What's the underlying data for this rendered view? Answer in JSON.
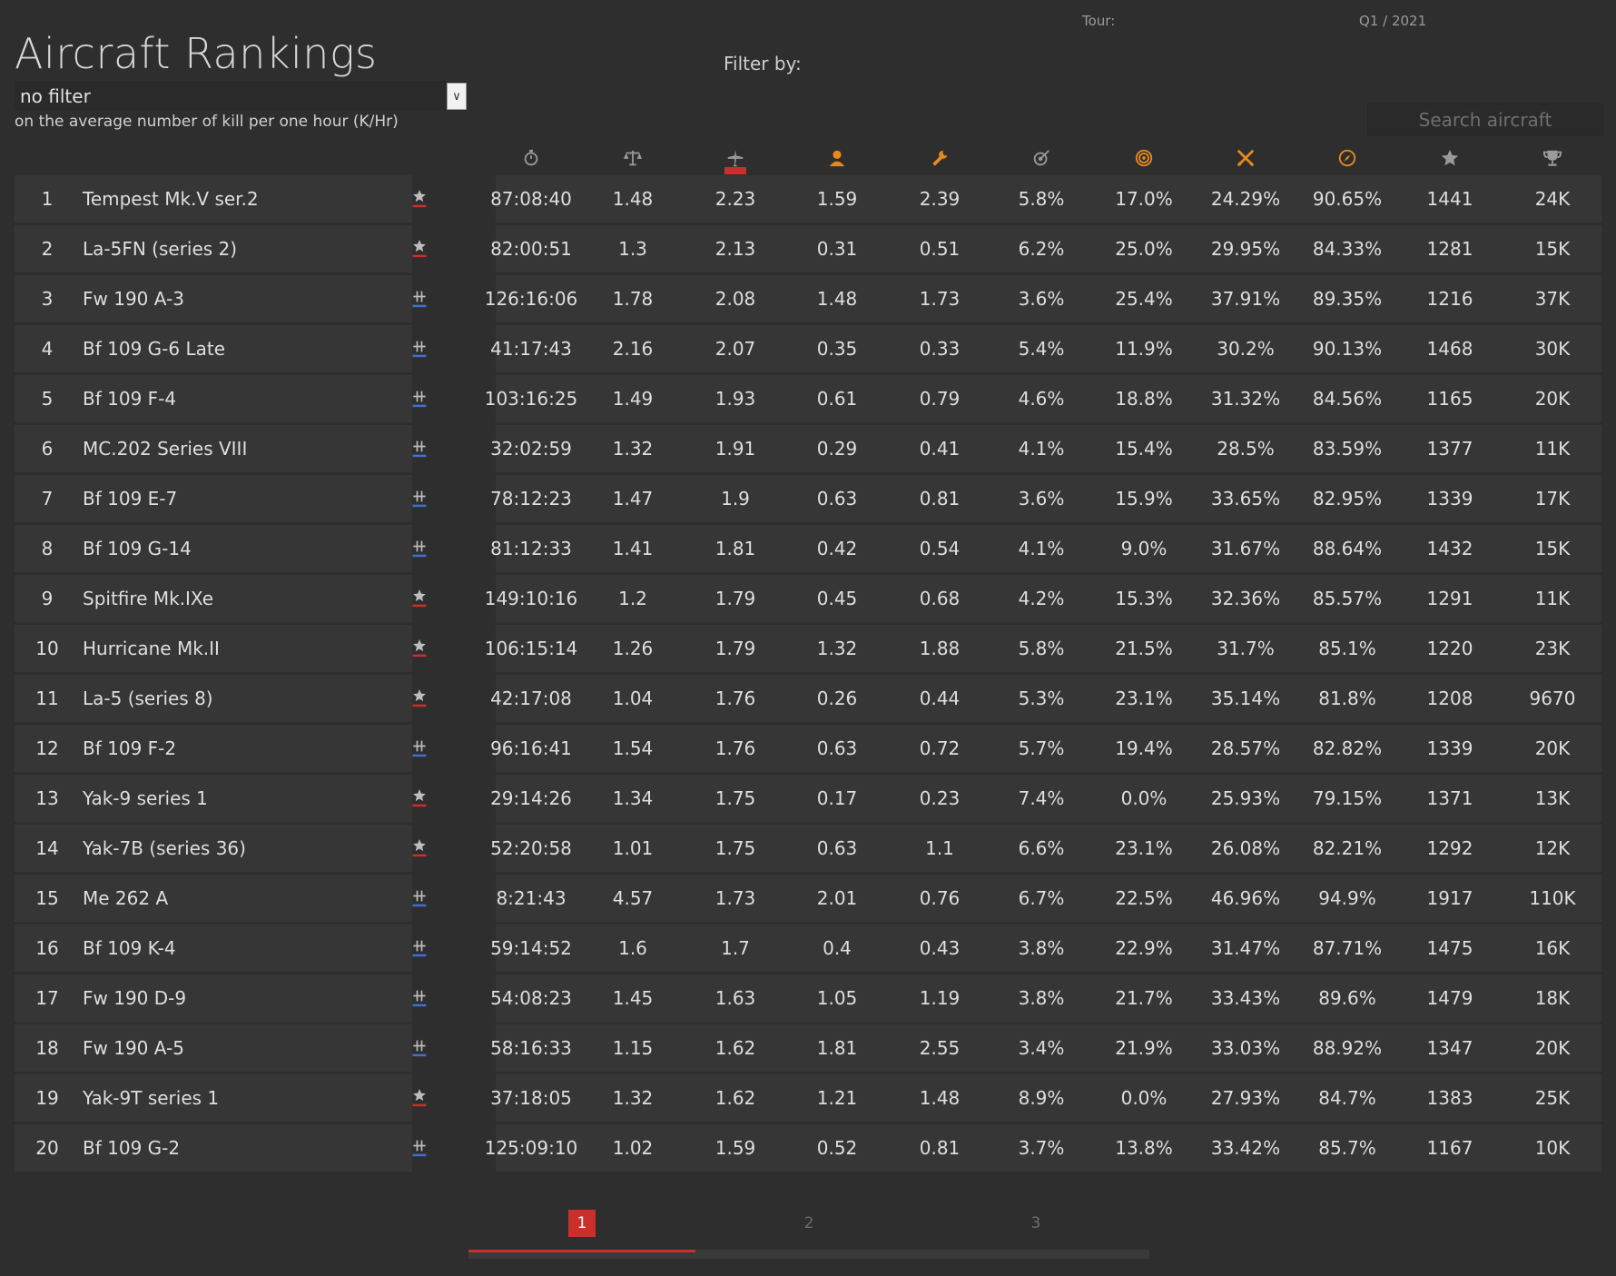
{
  "tour": {
    "label": "Tour:",
    "value": "Q1 / 2021"
  },
  "title": "Aircraft Rankings",
  "filter": {
    "label": "Filter by:",
    "selected": "no filter",
    "description": "on the average number of kill per one hour (K/Hr)"
  },
  "search": {
    "placeholder": "Search aircraft"
  },
  "columns": [
    {
      "icon": "stopwatch-icon",
      "color": "#9a9a9a"
    },
    {
      "icon": "scales-icon",
      "color": "#9a9a9a"
    },
    {
      "icon": "plane-kill-icon",
      "color": "#9a9a9a",
      "sorted": true
    },
    {
      "icon": "pilot-icon",
      "color": "#e58a1f"
    },
    {
      "icon": "wrench-icon",
      "color": "#e58a1f"
    },
    {
      "icon": "target-icon",
      "color": "#9a9a9a"
    },
    {
      "icon": "bullseye-icon",
      "color": "#e58a1f"
    },
    {
      "icon": "crossed-swords-icon",
      "color": "#e58a1f"
    },
    {
      "icon": "compass-icon",
      "color": "#e58a1f"
    },
    {
      "icon": "star-icon",
      "color": "#9a9a9a"
    },
    {
      "icon": "trophy-icon",
      "color": "#9a9a9a"
    }
  ],
  "colors": {
    "allies": "#c9302c",
    "axis": "#3f6fd1",
    "accent": "#c9302c"
  },
  "rows": [
    {
      "rank": "1",
      "name": "Tempest Mk.V ser.2",
      "side": "allies",
      "values": [
        "87:08:40",
        "1.48",
        "2.23",
        "1.59",
        "2.39",
        "5.8%",
        "17.0%",
        "24.29%",
        "90.65%",
        "1441",
        "24K"
      ]
    },
    {
      "rank": "2",
      "name": "La-5FN (series 2)",
      "side": "allies",
      "values": [
        "82:00:51",
        "1.3",
        "2.13",
        "0.31",
        "0.51",
        "6.2%",
        "25.0%",
        "29.95%",
        "84.33%",
        "1281",
        "15K"
      ]
    },
    {
      "rank": "3",
      "name": "Fw 190 A-3",
      "side": "axis",
      "values": [
        "126:16:06",
        "1.78",
        "2.08",
        "1.48",
        "1.73",
        "3.6%",
        "25.4%",
        "37.91%",
        "89.35%",
        "1216",
        "37K"
      ]
    },
    {
      "rank": "4",
      "name": "Bf 109 G-6 Late",
      "side": "axis",
      "values": [
        "41:17:43",
        "2.16",
        "2.07",
        "0.35",
        "0.33",
        "5.4%",
        "11.9%",
        "30.2%",
        "90.13%",
        "1468",
        "30K"
      ]
    },
    {
      "rank": "5",
      "name": "Bf 109 F-4",
      "side": "axis",
      "values": [
        "103:16:25",
        "1.49",
        "1.93",
        "0.61",
        "0.79",
        "4.6%",
        "18.8%",
        "31.32%",
        "84.56%",
        "1165",
        "20K"
      ]
    },
    {
      "rank": "6",
      "name": "MC.202 Series VIII",
      "side": "axis",
      "values": [
        "32:02:59",
        "1.32",
        "1.91",
        "0.29",
        "0.41",
        "4.1%",
        "15.4%",
        "28.5%",
        "83.59%",
        "1377",
        "11K"
      ]
    },
    {
      "rank": "7",
      "name": "Bf 109 E-7",
      "side": "axis",
      "values": [
        "78:12:23",
        "1.47",
        "1.9",
        "0.63",
        "0.81",
        "3.6%",
        "15.9%",
        "33.65%",
        "82.95%",
        "1339",
        "17K"
      ]
    },
    {
      "rank": "8",
      "name": "Bf 109 G-14",
      "side": "axis",
      "values": [
        "81:12:33",
        "1.41",
        "1.81",
        "0.42",
        "0.54",
        "4.1%",
        "9.0%",
        "31.67%",
        "88.64%",
        "1432",
        "15K"
      ]
    },
    {
      "rank": "9",
      "name": "Spitfire Mk.IXe",
      "side": "allies",
      "values": [
        "149:10:16",
        "1.2",
        "1.79",
        "0.45",
        "0.68",
        "4.2%",
        "15.3%",
        "32.36%",
        "85.57%",
        "1291",
        "11K"
      ]
    },
    {
      "rank": "10",
      "name": "Hurricane Mk.II",
      "side": "allies",
      "values": [
        "106:15:14",
        "1.26",
        "1.79",
        "1.32",
        "1.88",
        "5.8%",
        "21.5%",
        "31.7%",
        "85.1%",
        "1220",
        "23K"
      ]
    },
    {
      "rank": "11",
      "name": "La-5 (series 8)",
      "side": "allies",
      "values": [
        "42:17:08",
        "1.04",
        "1.76",
        "0.26",
        "0.44",
        "5.3%",
        "23.1%",
        "35.14%",
        "81.8%",
        "1208",
        "9670"
      ]
    },
    {
      "rank": "12",
      "name": "Bf 109 F-2",
      "side": "axis",
      "values": [
        "96:16:41",
        "1.54",
        "1.76",
        "0.63",
        "0.72",
        "5.7%",
        "19.4%",
        "28.57%",
        "82.82%",
        "1339",
        "20K"
      ]
    },
    {
      "rank": "13",
      "name": "Yak-9 series 1",
      "side": "allies",
      "values": [
        "29:14:26",
        "1.34",
        "1.75",
        "0.17",
        "0.23",
        "7.4%",
        "0.0%",
        "25.93%",
        "79.15%",
        "1371",
        "13K"
      ]
    },
    {
      "rank": "14",
      "name": "Yak-7B (series 36)",
      "side": "allies",
      "values": [
        "52:20:58",
        "1.01",
        "1.75",
        "0.63",
        "1.1",
        "6.6%",
        "23.1%",
        "26.08%",
        "82.21%",
        "1292",
        "12K"
      ]
    },
    {
      "rank": "15",
      "name": "Me 262 A",
      "side": "axis",
      "values": [
        "8:21:43",
        "4.57",
        "1.73",
        "2.01",
        "0.76",
        "6.7%",
        "22.5%",
        "46.96%",
        "94.9%",
        "1917",
        "110K"
      ]
    },
    {
      "rank": "16",
      "name": "Bf 109 K-4",
      "side": "axis",
      "values": [
        "59:14:52",
        "1.6",
        "1.7",
        "0.4",
        "0.43",
        "3.8%",
        "22.9%",
        "31.47%",
        "87.71%",
        "1475",
        "16K"
      ]
    },
    {
      "rank": "17",
      "name": "Fw 190 D-9",
      "side": "axis",
      "values": [
        "54:08:23",
        "1.45",
        "1.63",
        "1.05",
        "1.19",
        "3.8%",
        "21.7%",
        "33.43%",
        "89.6%",
        "1479",
        "18K"
      ]
    },
    {
      "rank": "18",
      "name": "Fw 190 A-5",
      "side": "axis",
      "values": [
        "58:16:33",
        "1.15",
        "1.62",
        "1.81",
        "2.55",
        "3.4%",
        "21.9%",
        "33.03%",
        "88.92%",
        "1347",
        "20K"
      ]
    },
    {
      "rank": "19",
      "name": "Yak-9T series 1",
      "side": "allies",
      "values": [
        "37:18:05",
        "1.32",
        "1.62",
        "1.21",
        "1.48",
        "8.9%",
        "0.0%",
        "27.93%",
        "84.7%",
        "1383",
        "25K"
      ]
    },
    {
      "rank": "20",
      "name": "Bf 109 G-2",
      "side": "axis",
      "values": [
        "125:09:10",
        "1.02",
        "1.59",
        "0.52",
        "0.81",
        "3.7%",
        "13.8%",
        "33.42%",
        "85.7%",
        "1167",
        "10K"
      ]
    }
  ],
  "pagination": {
    "pages": [
      "1",
      "2",
      "3"
    ],
    "current": "1",
    "progress": 0.3333
  }
}
